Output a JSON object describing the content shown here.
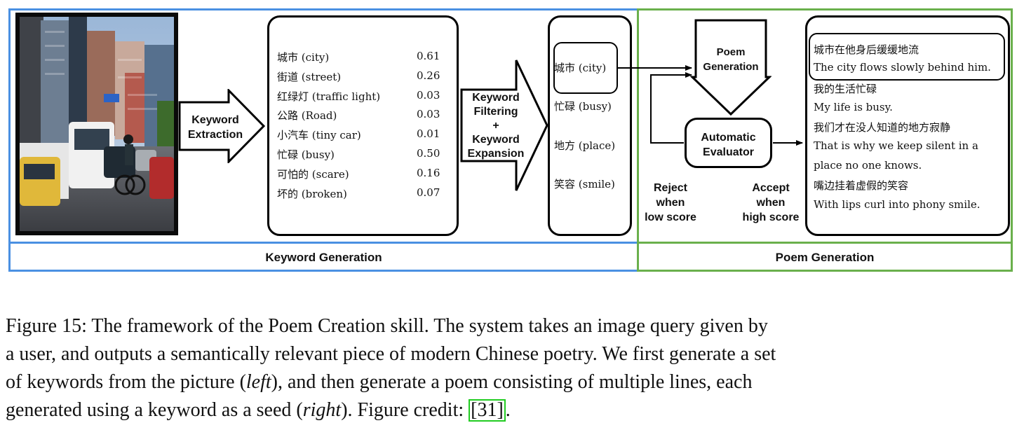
{
  "sections": {
    "left_label": "Keyword Generation",
    "right_label": "Poem Generation"
  },
  "steps": {
    "extraction_line1": "Keyword",
    "extraction_line2": "Extraction",
    "filter_line1": "Keyword",
    "filter_line2": "Filtering",
    "filter_line3": "+",
    "filter_line4": "Keyword",
    "filter_line5": "Expansion",
    "poem_gen_line1": "Poem",
    "poem_gen_line2": "Generation",
    "evaluator_line1": "Automatic",
    "evaluator_line2": "Evaluator",
    "reject_line1": "Reject",
    "reject_line2": "when",
    "reject_line3": "low score",
    "accept_line1": "Accept",
    "accept_line2": "when",
    "accept_line3": "high score"
  },
  "keywords": [
    {
      "term": "城市 (city)",
      "score": "0.61"
    },
    {
      "term": "街道 (street)",
      "score": "0.26"
    },
    {
      "term": "红绿灯 (traffic light)",
      "score": "0.03"
    },
    {
      "term": "公路 (Road)",
      "score": "0.03"
    },
    {
      "term": "小汽车 (tiny car)",
      "score": "0.01"
    },
    {
      "term": "忙碌 (busy)",
      "score": "0.50"
    },
    {
      "term": "可怕的 (scare)",
      "score": "0.16"
    },
    {
      "term": "坏的 (broken)",
      "score": "0.07"
    }
  ],
  "selected_keywords": [
    "城市 (city)",
    "忙碌 (busy)",
    "地方 (place)",
    "笑容 (smile)"
  ],
  "poem_lines": [
    "城市在他身后缓缓地流",
    "The city flows slowly behind him.",
    "我的生活忙碌",
    "My life is busy.",
    "我们才在没人知道的地方寂静",
    "That is why we keep silent in a",
    "place no one knows.",
    "嘴边挂着虚假的笑容",
    "With lips curl into phony smile."
  ],
  "caption": {
    "line1": "Figure 15: The framework of the Poem Creation skill. The system takes an image query given by",
    "line2": "a user, and outputs a semantically relevant piece of modern Chinese poetry. We first generate a set",
    "line3_a": "of keywords from the picture (",
    "line3_b": "left",
    "line3_c": "), and then generate a poem consisting of multiple lines, each",
    "line4_a": "generated using a keyword as a seed (",
    "line4_b": "right",
    "line4_c": "). Figure credit: ",
    "citation": "[31]",
    "line4_d": "."
  },
  "colors": {
    "keyword_section_border": "#4a90e2",
    "poem_section_border": "#6ab04c",
    "citation_border": "#22cc22"
  }
}
